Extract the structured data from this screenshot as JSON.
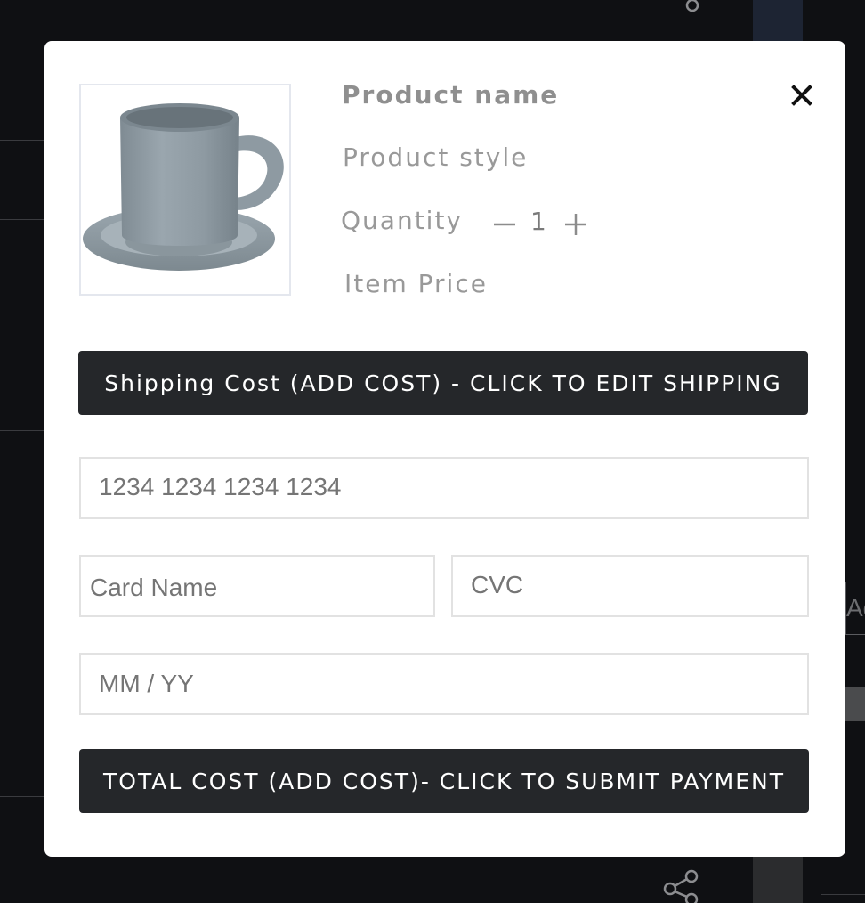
{
  "modal": {
    "product_name": "Product name",
    "product_style": "Product style",
    "quantity_label": "Quantity",
    "quantity_value": "1",
    "item_price_label": "Item Price",
    "shipping_button_label": "Shipping Cost (ADD COST) - CLICK TO EDIT SHIPPING",
    "submit_button_label": "TOTAL COST (ADD COST)- CLICK TO SUBMIT PAYMENT",
    "fields": {
      "card_number_placeholder": "1234 1234 1234 1234",
      "card_name_placeholder": "Card Name",
      "cvc_placeholder": "CVC",
      "expiry_placeholder": "MM / YY"
    },
    "icons": {
      "close": "close-icon",
      "minus": "minus-icon",
      "plus": "plus-icon",
      "product": "mug-image"
    }
  },
  "background": {
    "side_text": "Ad",
    "icons": [
      "share-icon",
      "share-icon"
    ]
  },
  "colors": {
    "backdrop": "#0f1013",
    "modal": "#ffffff",
    "button": "#25272a",
    "button_text": "#ffffff",
    "label_text": "#999999",
    "field_border": "#e2e2e2"
  }
}
